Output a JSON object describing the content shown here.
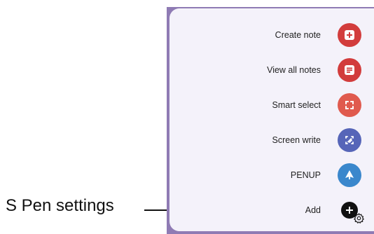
{
  "menu": {
    "items": [
      {
        "label": "Create note",
        "icon": "create-note-icon",
        "color": "#d23c3c"
      },
      {
        "label": "View all notes",
        "icon": "view-all-notes-icon",
        "color": "#d23c3c"
      },
      {
        "label": "Smart select",
        "icon": "smart-select-icon",
        "color": "#e05a4e"
      },
      {
        "label": "Screen write",
        "icon": "screen-write-icon",
        "color": "#5665b8"
      },
      {
        "label": "PENUP",
        "icon": "penup-icon",
        "color": "#3a87cc"
      },
      {
        "label": "Add",
        "icon": "add-icon",
        "color": "#111111"
      }
    ]
  },
  "settings": {
    "icon": "gear-icon"
  },
  "callout": {
    "label": "S Pen settings"
  },
  "colors": {
    "panel_bg": "#f4f2fa",
    "phone_frame": "#8f7bb4",
    "text": "#222222"
  }
}
